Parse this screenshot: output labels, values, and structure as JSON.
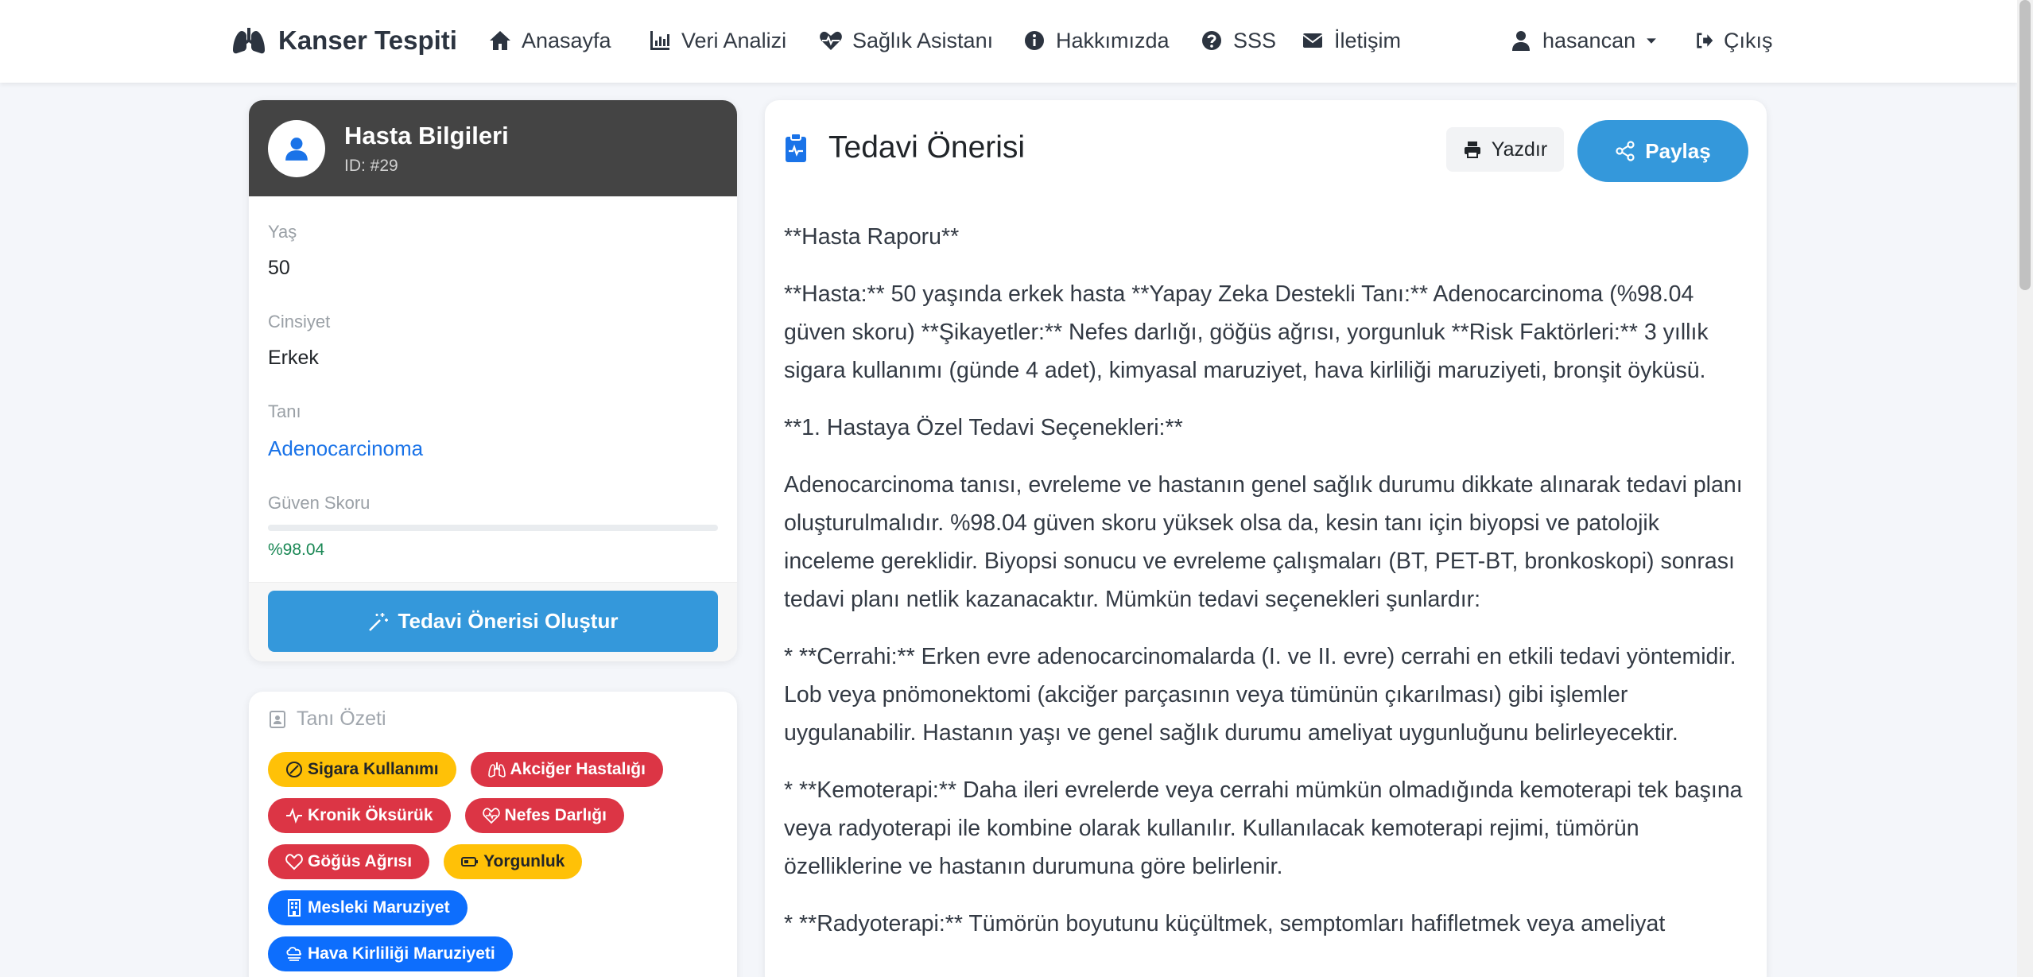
{
  "navbar": {
    "brand": "Kanser Tespiti",
    "items": [
      {
        "label": "Anasayfa",
        "icon": "home-icon"
      },
      {
        "label": "Veri Analizi",
        "icon": "chart-icon"
      },
      {
        "label": "Sağlık Asistanı",
        "icon": "heartbeat-icon"
      },
      {
        "label": "Hakkımızda",
        "icon": "info-icon"
      },
      {
        "label": "SSS",
        "icon": "question-icon"
      },
      {
        "label": "İletişim",
        "icon": "envelope-icon"
      }
    ],
    "user": "hasancan",
    "logout": "Çıkış"
  },
  "patient": {
    "title": "Hasta Bilgileri",
    "id": "ID: #29",
    "age_label": "Yaş",
    "age": "50",
    "gender_label": "Cinsiyet",
    "gender": "Erkek",
    "diagnosis_label": "Tanı",
    "diagnosis": "Adenocarcinoma",
    "score_label": "Güven Skoru",
    "score": "%98.04",
    "score_value": 0.9804,
    "generate_button": "Tedavi Önerisi Oluştur"
  },
  "summary": {
    "title": "Tanı Özeti",
    "tags": [
      {
        "label": "Sigara Kullanımı",
        "style": "warn",
        "icon": "smoking-icon"
      },
      {
        "label": "Akciğer Hastalığı",
        "style": "danger",
        "icon": "lungs-icon"
      },
      {
        "label": "Kronik Öksürük",
        "style": "danger",
        "icon": "activity-icon"
      },
      {
        "label": "Nefes Darlığı",
        "style": "danger",
        "icon": "heart-pulse-icon"
      },
      {
        "label": "Göğüs Ağrısı",
        "style": "danger",
        "icon": "heart-icon"
      },
      {
        "label": "Yorgunluk",
        "style": "warn",
        "icon": "battery-icon"
      },
      {
        "label": "Mesleki Maruziyet",
        "style": "primary",
        "icon": "building-icon"
      },
      {
        "label": "Hava Kirliliği Maruziyeti",
        "style": "primary",
        "icon": "cloud-haze-icon"
      }
    ]
  },
  "treatment": {
    "title": "Tedavi Önerisi",
    "print": "Yazdır",
    "share": "Paylaş",
    "paragraphs": [
      "**Hasta Raporu**",
      "**Hasta:** 50 yaşında erkek hasta **Yapay Zeka Destekli Tanı:** Adenocarcinoma (%98.04 güven skoru) **Şikayetler:** Nefes darlığı, göğüs ağrısı, yorgunluk **Risk Faktörleri:** 3 yıllık sigara kullanımı (günde 4 adet), kimyasal maruziyet, hava kirliliği maruziyeti, bronşit öyküsü.",
      "**1. Hastaya Özel Tedavi Seçenekleri:**",
      "Adenocarcinoma tanısı, evreleme ve hastanın genel sağlık durumu dikkate alınarak tedavi planı oluşturulmalıdır. %98.04 güven skoru yüksek olsa da, kesin tanı için biyopsi ve patolojik inceleme gereklidir. Biyopsi sonucu ve evreleme çalışmaları (BT, PET-BT, bronkoskopi) sonrası tedavi planı netlik kazanacaktır. Mümkün tedavi seçenekleri şunlardır:",
      "* **Cerrahi:** Erken evre adenocarcinomalarda (I. ve II. evre) cerrahi en etkili tedavi yöntemidir. Lob veya pnömonektomi (akciğer parçasının veya tümünün çıkarılması) gibi işlemler uygulanabilir. Hastanın yaşı ve genel sağlık durumu ameliyat uygunluğunu belirleyecektir.",
      "* **Kemoterapi:** Daha ileri evrelerde veya cerrahi mümkün olmadığında kemoterapi tek başına veya radyoterapi ile kombine olarak kullanılır. Kullanılacak kemoterapi rejimi, tümörün özelliklerine ve hastanın durumuna göre belirlenir.",
      "* **Radyoterapi:** Tümörün boyutunu küçültmek, semptomları hafifletmek veya ameliyat"
    ]
  }
}
